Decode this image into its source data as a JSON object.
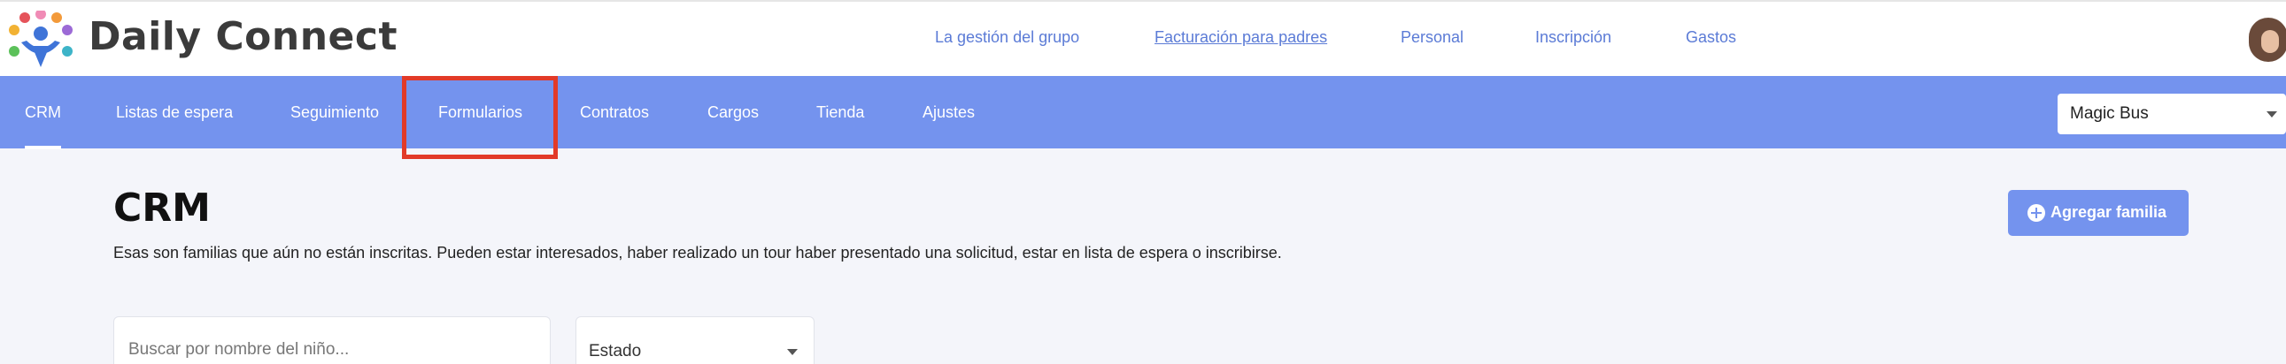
{
  "header": {
    "brand": "Daily Connect",
    "links": [
      {
        "label": "La gestión del grupo",
        "underlined": false
      },
      {
        "label": "Facturación para padres",
        "underlined": true
      },
      {
        "label": "Personal",
        "underlined": false
      },
      {
        "label": "Inscripción",
        "underlined": false
      },
      {
        "label": "Gastos",
        "underlined": false
      }
    ],
    "avatar_icon": "user-avatar-icon"
  },
  "nav": {
    "items": [
      {
        "label": "CRM",
        "active": true
      },
      {
        "label": "Listas de espera",
        "active": false
      },
      {
        "label": "Seguimiento",
        "active": false
      },
      {
        "label": "Formularios",
        "active": false,
        "highlighted": true
      },
      {
        "label": "Contratos",
        "active": false
      },
      {
        "label": "Cargos",
        "active": false
      },
      {
        "label": "Tienda",
        "active": false
      },
      {
        "label": "Ajustes",
        "active": false
      }
    ],
    "school_select": {
      "value": "Magic Bus"
    }
  },
  "main": {
    "title": "CRM",
    "description": "Esas son familias que aún no están inscritas. Pueden estar interesados, haber realizado un tour haber presentado una solicitud, estar en lista de espera o inscribirse.",
    "add_button": {
      "label": "Agregar familia",
      "icon": "plus-circle-icon"
    },
    "search": {
      "placeholder": "Buscar por nombre del niño...",
      "value": ""
    },
    "status_filter": {
      "value": "Estado"
    }
  },
  "colors": {
    "accent": "#7493ee",
    "link": "#5b7bd6",
    "highlight_border": "#e23a28",
    "background": "#f4f5fa"
  }
}
